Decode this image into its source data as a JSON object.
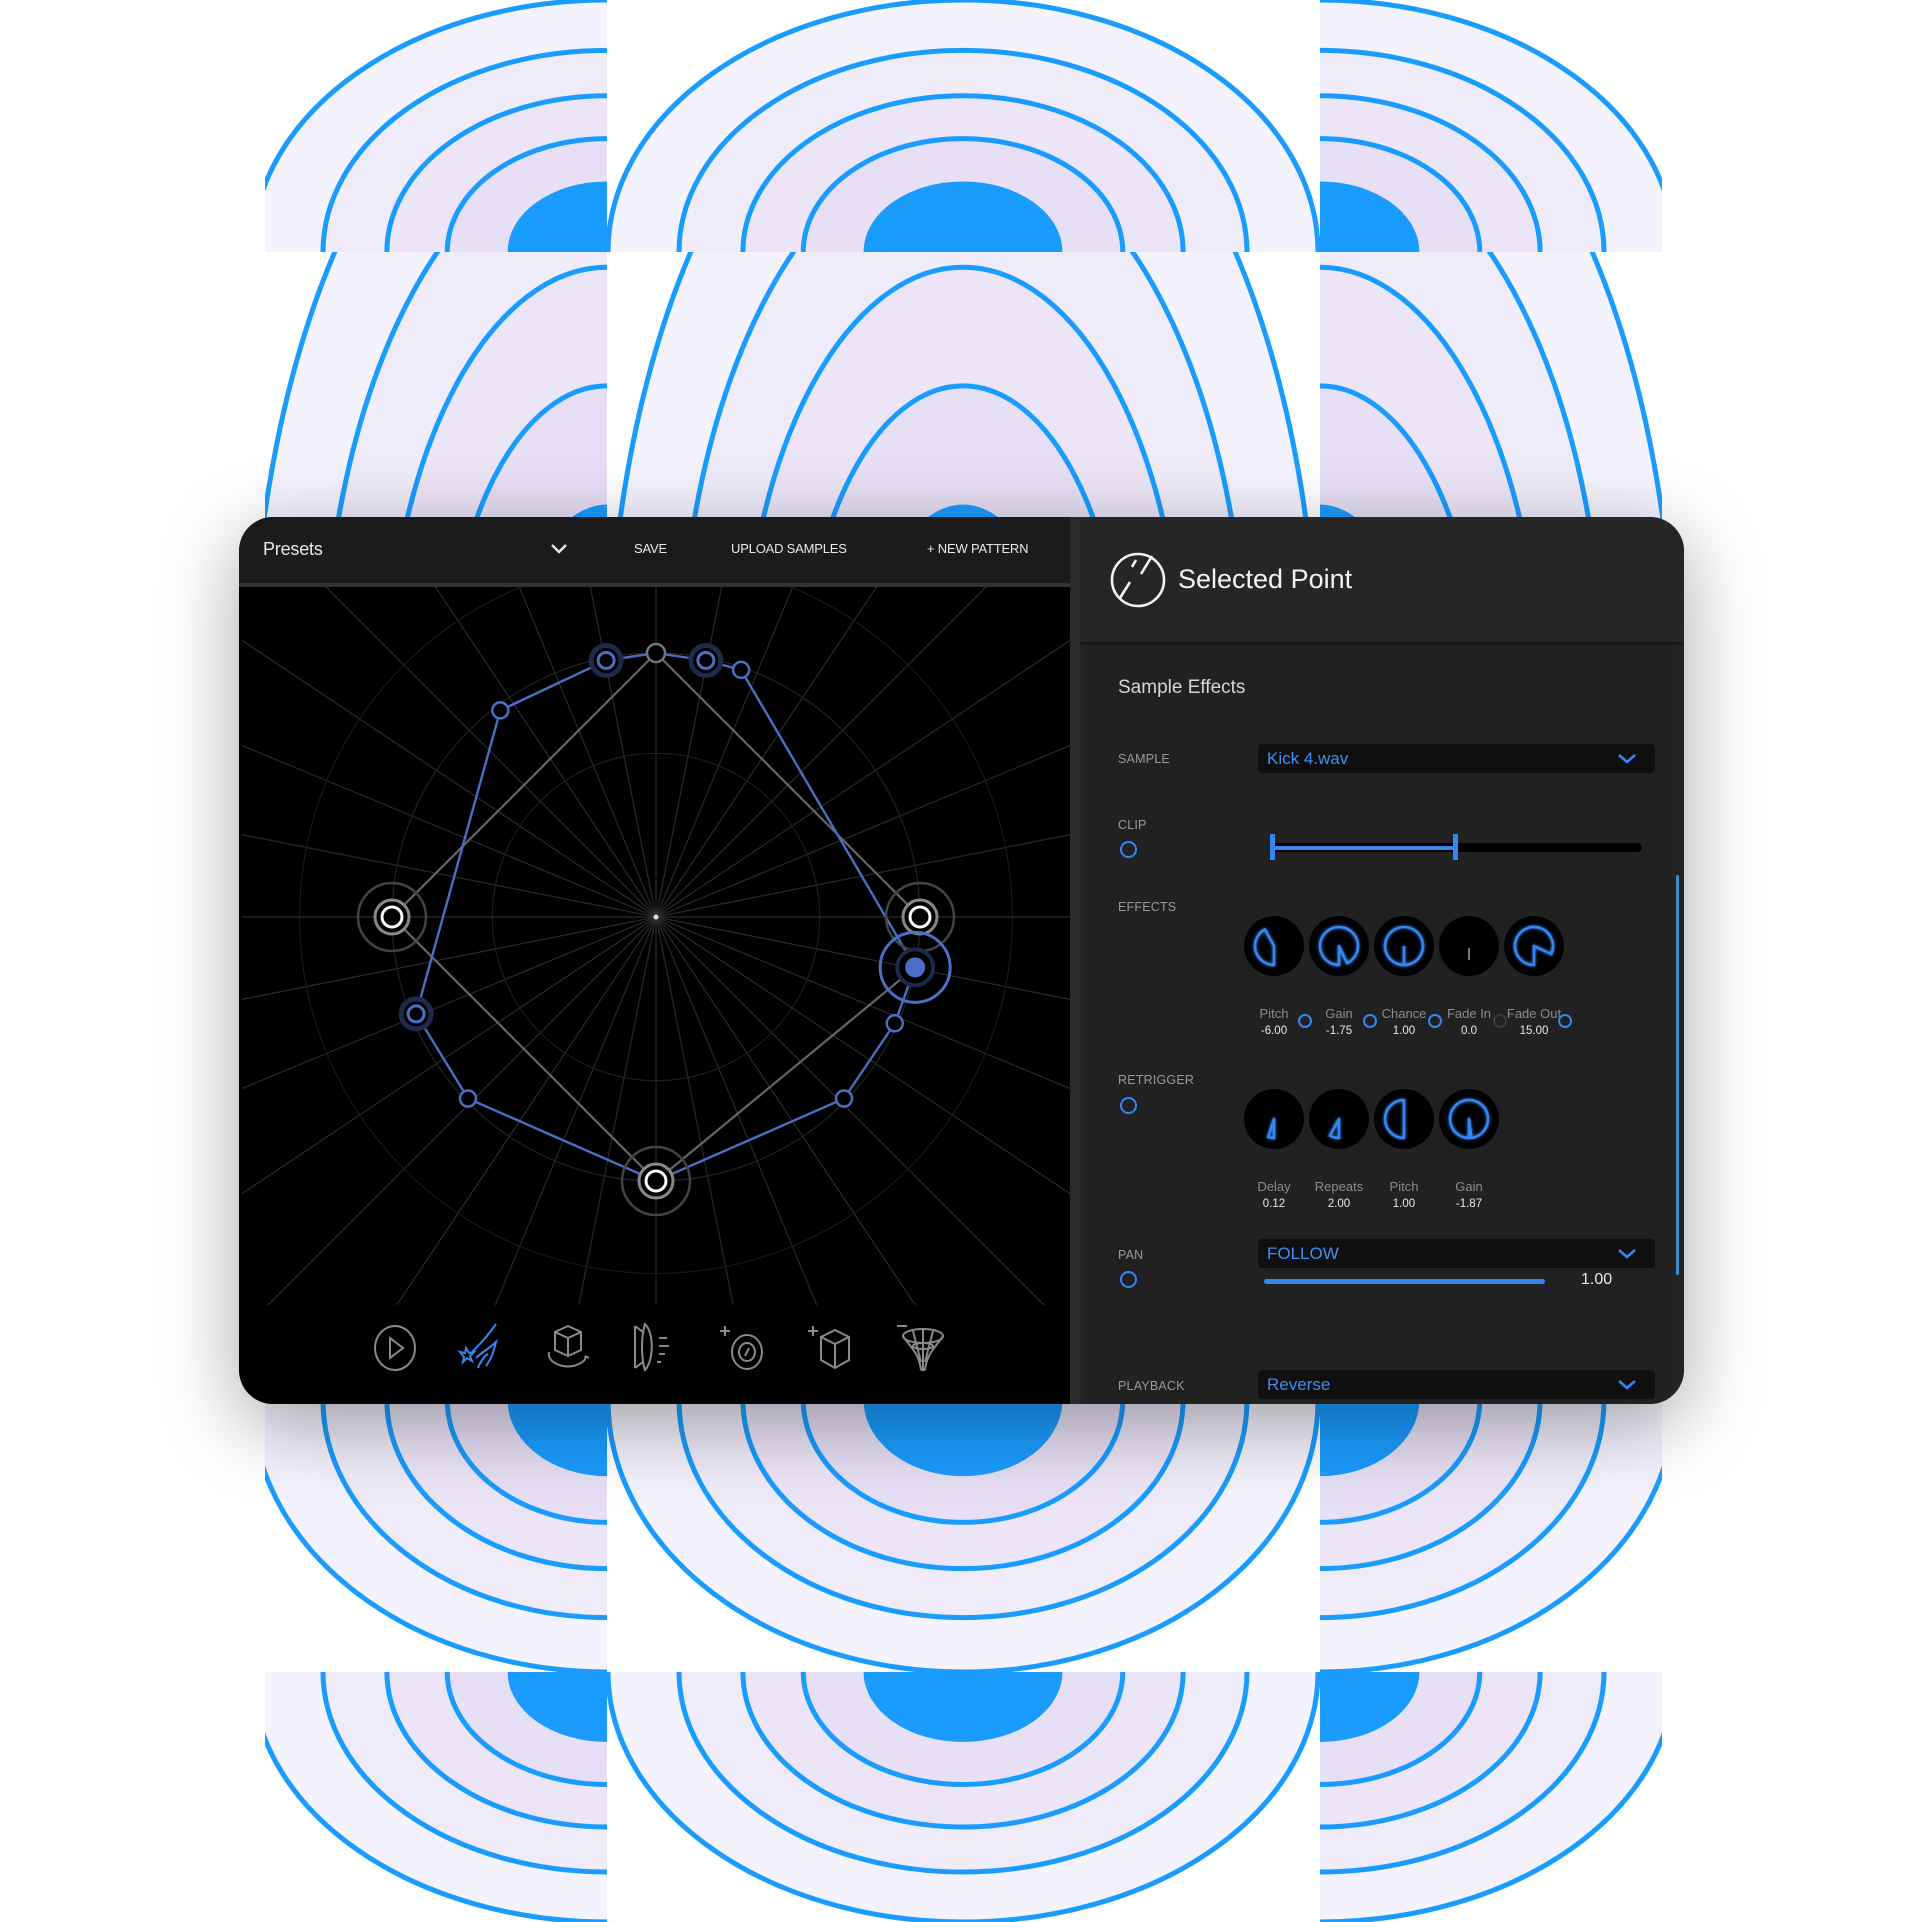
{
  "colors": {
    "accent": "#3586f0",
    "accent_text": "#3e8ff5",
    "bg_blue": "#1a9cff",
    "node_blue": "#4a6fc4",
    "graph_gray": "#666666"
  },
  "left_panel": {
    "presets_label": "Presets",
    "save_label": "SAVE",
    "upload_label": "UPLOAD SAMPLES",
    "new_pattern_label": "+ NEW PATTERN",
    "graph": {
      "spokes": 32,
      "nodes": [
        {
          "id": "top",
          "kind": "small-gray",
          "angle": 90,
          "radius": 1.0
        },
        {
          "id": "n1",
          "kind": "blue-ring",
          "angle": 101,
          "radius": 0.99
        },
        {
          "id": "n2",
          "kind": "blue-ring",
          "angle": 79,
          "radius": 0.99
        },
        {
          "id": "n3",
          "kind": "small-blue",
          "angle": 71,
          "radius": 0.99
        },
        {
          "id": "n4",
          "kind": "small-blue",
          "angle": 127,
          "radius": 0.98
        },
        {
          "id": "left",
          "kind": "white",
          "angle": 180,
          "radius": 1.0
        },
        {
          "id": "right",
          "kind": "white",
          "angle": 0,
          "radius": 1.0
        },
        {
          "id": "selected",
          "kind": "selected",
          "angle": -11,
          "radius": 1.0
        },
        {
          "id": "n5",
          "kind": "blue-ring",
          "angle": -158,
          "radius": 0.98
        },
        {
          "id": "n6",
          "kind": "small-blue",
          "angle": -24,
          "radius": 0.99
        },
        {
          "id": "n7",
          "kind": "small-blue",
          "angle": -136,
          "radius": 0.99
        },
        {
          "id": "n8",
          "kind": "small-blue",
          "angle": -44,
          "radius": 0.99
        },
        {
          "id": "bottom",
          "kind": "white",
          "angle": -90,
          "radius": 1.0
        }
      ],
      "blue_path": [
        "top",
        "n2",
        "n3",
        "selected",
        "n6",
        "n8",
        "bottom",
        "n7",
        "n5",
        "n4",
        "n1",
        "top"
      ],
      "gray_edges": [
        [
          "top",
          "right"
        ],
        [
          "top",
          "left"
        ],
        [
          "left",
          "bottom"
        ],
        [
          "bottom",
          "selected"
        ]
      ]
    },
    "toolbar": [
      {
        "name": "play-icon",
        "active": false
      },
      {
        "name": "shooting-star-hand-icon",
        "active": true
      },
      {
        "name": "rotate-cube-icon",
        "active": false
      },
      {
        "name": "mirror-speed-icon",
        "active": false
      },
      {
        "name": "add-knob-icon",
        "active": false
      },
      {
        "name": "add-cube-icon",
        "active": false
      },
      {
        "name": "remove-funnel-icon",
        "active": false
      }
    ]
  },
  "right_panel": {
    "title": "Selected Point",
    "section_title": "Sample Effects",
    "sample": {
      "label": "SAMPLE",
      "value": "Kick 4.wav"
    },
    "clip": {
      "label": "CLIP",
      "enabled": true,
      "start": 0.0,
      "end": 0.5
    },
    "effects": {
      "label": "EFFECTS",
      "knobs": [
        {
          "name": "Pitch",
          "value": "-6.00",
          "fraction": 0.42,
          "enabled": true
        },
        {
          "name": "Gain",
          "value": "-1.75",
          "fraction": 0.93,
          "enabled": true
        },
        {
          "name": "Chance",
          "value": "1.00",
          "fraction": 1.0,
          "enabled": true
        },
        {
          "name": "Fade In",
          "value": "0.0",
          "fraction": 0.0,
          "enabled": false
        },
        {
          "name": "Fade Out",
          "value": "15.00",
          "fraction": 0.82,
          "enabled": true
        }
      ]
    },
    "retrigger": {
      "label": "RETRIGGER",
      "enabled": true,
      "knobs": [
        {
          "name": "Delay",
          "value": "0.12",
          "fraction": 0.05
        },
        {
          "name": "Repeats",
          "value": "2.00",
          "fraction": 0.08
        },
        {
          "name": "Pitch",
          "value": "1.00",
          "fraction": 0.5
        },
        {
          "name": "Gain",
          "value": "-1.87",
          "fraction": 0.98
        }
      ]
    },
    "pan": {
      "label": "PAN",
      "mode": "FOLLOW",
      "value": "1.00",
      "fraction": 1.0,
      "enabled": true
    },
    "playback": {
      "label": "PLAYBACK",
      "value": "Reverse"
    }
  }
}
